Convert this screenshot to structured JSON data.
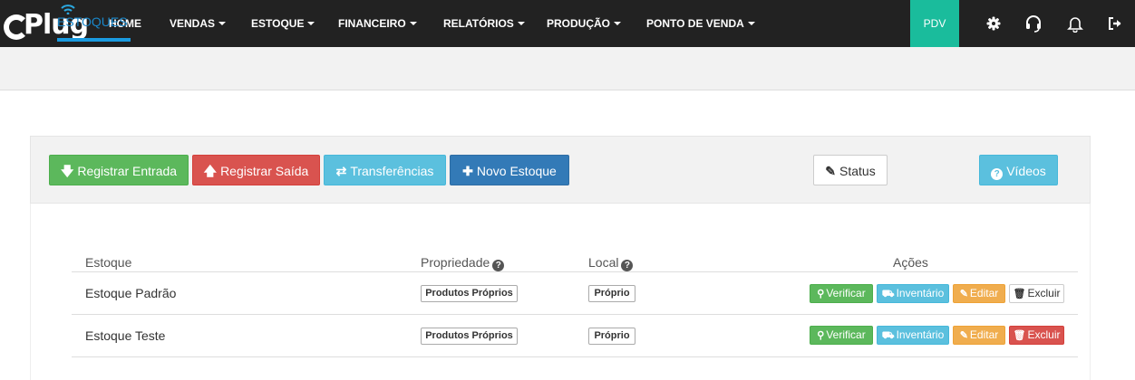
{
  "brand": {
    "name": "CPlug"
  },
  "nav": {
    "items": [
      {
        "label": "HOME",
        "dropdown": false
      },
      {
        "label": "VENDAS",
        "dropdown": true
      },
      {
        "label": "ESTOQUE",
        "dropdown": true
      },
      {
        "label": "FINANCEIRO",
        "dropdown": true
      },
      {
        "label": "RELATÓRIOS",
        "dropdown": true
      },
      {
        "label": "PRODUÇÃO",
        "dropdown": true
      },
      {
        "label": "PONTO DE VENDA",
        "dropdown": true
      }
    ],
    "pdv_label": "PDV",
    "icons": [
      "gear-icon",
      "headset-icon",
      "bell-icon",
      "logout-icon"
    ]
  },
  "subheader": {
    "tab_label": "ESTOQUES"
  },
  "toolbar": {
    "registrar_entrada": "Registrar Entrada",
    "registrar_saida": "Registrar Saída",
    "transferencias": "Transferências",
    "novo_estoque": "Novo Estoque",
    "status": "Status",
    "videos": "Vídeos"
  },
  "table": {
    "headers": {
      "estoque": "Estoque",
      "propriedade": "Propriedade",
      "local": "Local",
      "acoes": "Ações"
    },
    "rows": [
      {
        "estoque": "Estoque Padrão",
        "propriedade": "Produtos Próprios",
        "local": "Próprio",
        "delete_style": "default"
      },
      {
        "estoque": "Estoque Teste",
        "propriedade": "Produtos Próprios",
        "local": "Próprio",
        "delete_style": "danger"
      }
    ],
    "actions": {
      "verificar": "Verificar",
      "inventario": "Inventário",
      "editar": "Editar",
      "excluir": "Excluir"
    }
  },
  "colors": {
    "navbar": "#222222",
    "pdv": "#1abc9c",
    "accent": "#1a87c9",
    "success": "#5cb85c",
    "danger": "#d9534f",
    "info": "#5bc0de",
    "primary": "#337ab7",
    "warning": "#f0ad4e"
  }
}
